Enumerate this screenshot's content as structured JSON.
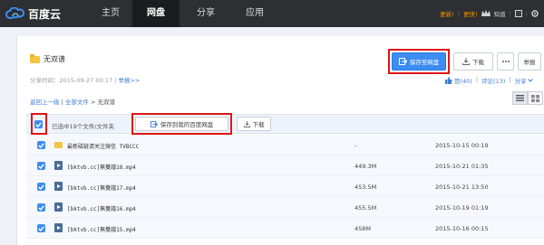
{
  "topbar": {
    "logo_text": "百度云",
    "nav": [
      "主页",
      "网盘",
      "分享",
      "应用"
    ],
    "active_nav": "网盘",
    "right": {
      "update_label": "更新!",
      "promo_label": "更快!",
      "zhidao_label": "知道",
      "divider": "|"
    }
  },
  "share": {
    "folder_name": "无双谱",
    "time_label": "分享时间：2015-09-27 00:17",
    "divider": "|",
    "report_link": "举报>>",
    "save_button": "保存至网盘",
    "download_button": "下载",
    "report_button": "举报",
    "likes_label": "赞(40)",
    "comments_label": "评论(13)",
    "share_label": "分享"
  },
  "breadcrumb": {
    "back": "返回上一级",
    "sep": "|",
    "all_files": "全部文件",
    "arrow": ">",
    "current": "无双谱"
  },
  "list_header": {
    "selected_text": "已选中19个文件/文件夹",
    "save_to_pan": "保存到我的百度网盘",
    "download": "下载"
  },
  "files": [
    {
      "name": "最新磁链请关注微信 TVBCCC",
      "type": "folder",
      "size": "-",
      "date": "2015-10-15 00:19"
    },
    {
      "name": "[bktvb.cc]無雙譜18.mp4",
      "type": "video",
      "size": "449.3M",
      "date": "2015-10-21 01:35"
    },
    {
      "name": "[bktvb.cc]無雙譜17.mp4",
      "type": "video",
      "size": "453.5M",
      "date": "2015-10-21 13:50"
    },
    {
      "name": "[bktvb.cc]無雙譜16.mp4",
      "type": "video",
      "size": "455.5M",
      "date": "2015-10-19 01:19"
    },
    {
      "name": "[bktvb.cc]無雙譜15.mp4",
      "type": "video",
      "size": "458M",
      "date": "2015-10-16 00:15"
    }
  ],
  "colors": {
    "accent": "#3c8df2",
    "highlight_box": "#e01515",
    "topbar": "#2d2f33"
  }
}
